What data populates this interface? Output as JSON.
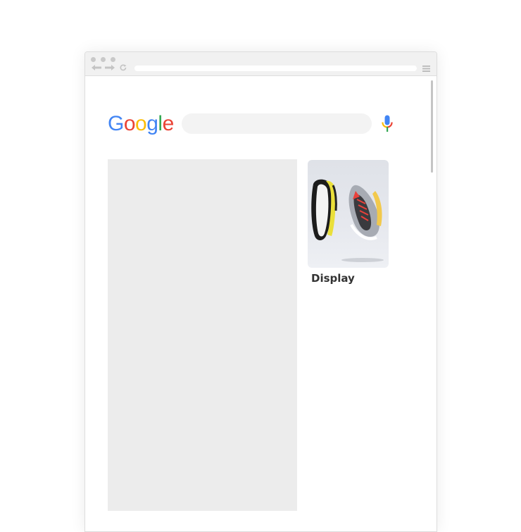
{
  "browser": {
    "window_controls": [
      "dot",
      "dot",
      "dot"
    ],
    "nav_icons": [
      "back-arrow-icon",
      "forward-arrow-icon",
      "reload-icon"
    ],
    "address_value": "",
    "menu_icon": "hamburger-menu-icon"
  },
  "search": {
    "logo_letters": [
      {
        "char": "G",
        "color": "#4285F4"
      },
      {
        "char": "o",
        "color": "#EA4335"
      },
      {
        "char": "o",
        "color": "#FBBC05"
      },
      {
        "char": "g",
        "color": "#4285F4"
      },
      {
        "char": "l",
        "color": "#34A853"
      },
      {
        "char": "e",
        "color": "#EA4335"
      }
    ],
    "query_value": "",
    "mic_icon": "microphone-icon"
  },
  "results": {
    "ad_card": {
      "image": "sneaker-product-image",
      "label": "Display"
    }
  }
}
